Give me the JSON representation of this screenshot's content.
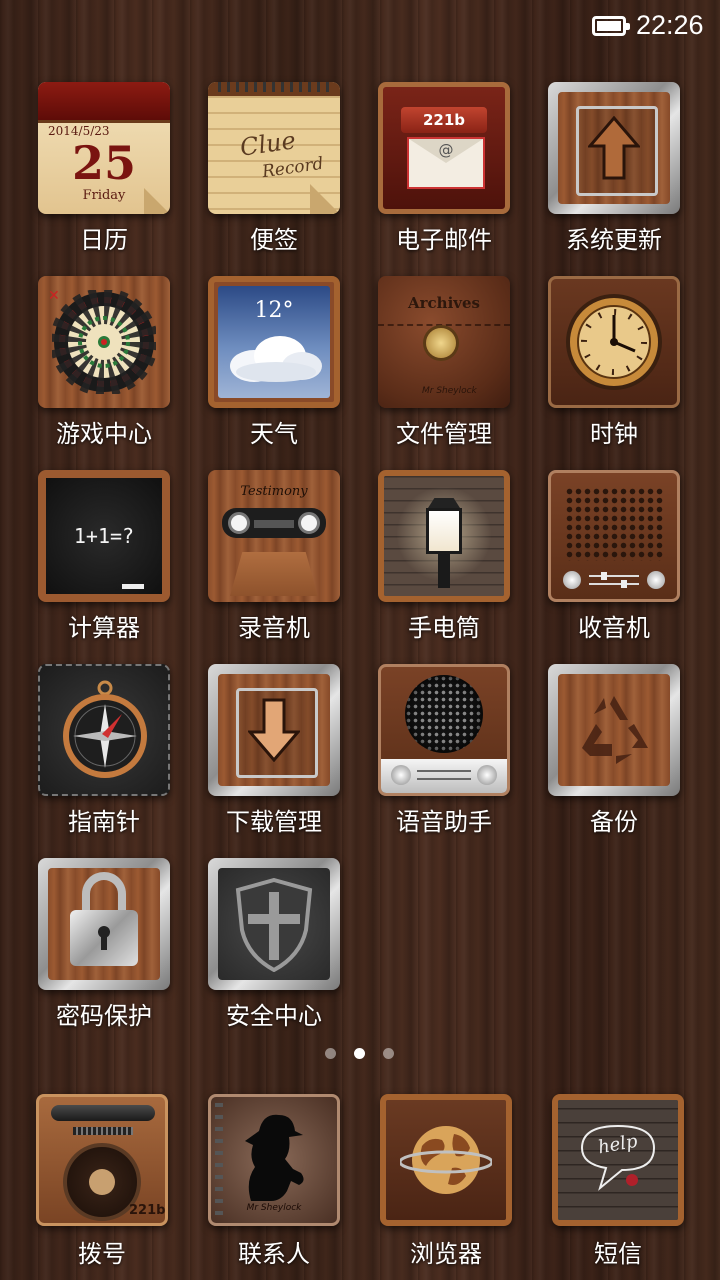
{
  "status_bar": {
    "time": "22:26",
    "battery": "full"
  },
  "apps": {
    "calendar": {
      "label": "日历",
      "date": "2014/5/23",
      "day": "25",
      "weekday": "Friday"
    },
    "notes": {
      "label": "便签",
      "title_line1": "Clue",
      "title_line2": "Record"
    },
    "email": {
      "label": "电子邮件",
      "plate": "221b",
      "symbol": "@"
    },
    "system_update": {
      "label": "系统更新"
    },
    "game_center": {
      "label": "游戏中心"
    },
    "weather": {
      "label": "天气",
      "temperature": "12°"
    },
    "file_manager": {
      "label": "文件管理",
      "title": "Archives",
      "signature": "Mr Sheylock"
    },
    "clock": {
      "label": "时钟"
    },
    "calculator": {
      "label": "计算器",
      "expression": "1+1=?"
    },
    "recorder": {
      "label": "录音机",
      "title": "Testimony"
    },
    "flashlight": {
      "label": "手电筒"
    },
    "radio": {
      "label": "收音机"
    },
    "compass": {
      "label": "指南针"
    },
    "download_manager": {
      "label": "下载管理"
    },
    "voice_assistant": {
      "label": "语音助手"
    },
    "backup": {
      "label": "备份"
    },
    "password_protect": {
      "label": "密码保护"
    },
    "security_center": {
      "label": "安全中心"
    }
  },
  "page_indicator": {
    "count": 3,
    "active": 2
  },
  "dock": {
    "dialer": {
      "label": "拨号",
      "plate": "221b"
    },
    "contacts": {
      "label": "联系人",
      "signature": "Mr Sheylock"
    },
    "browser": {
      "label": "浏览器"
    },
    "messages": {
      "label": "短信",
      "word": "help"
    }
  }
}
